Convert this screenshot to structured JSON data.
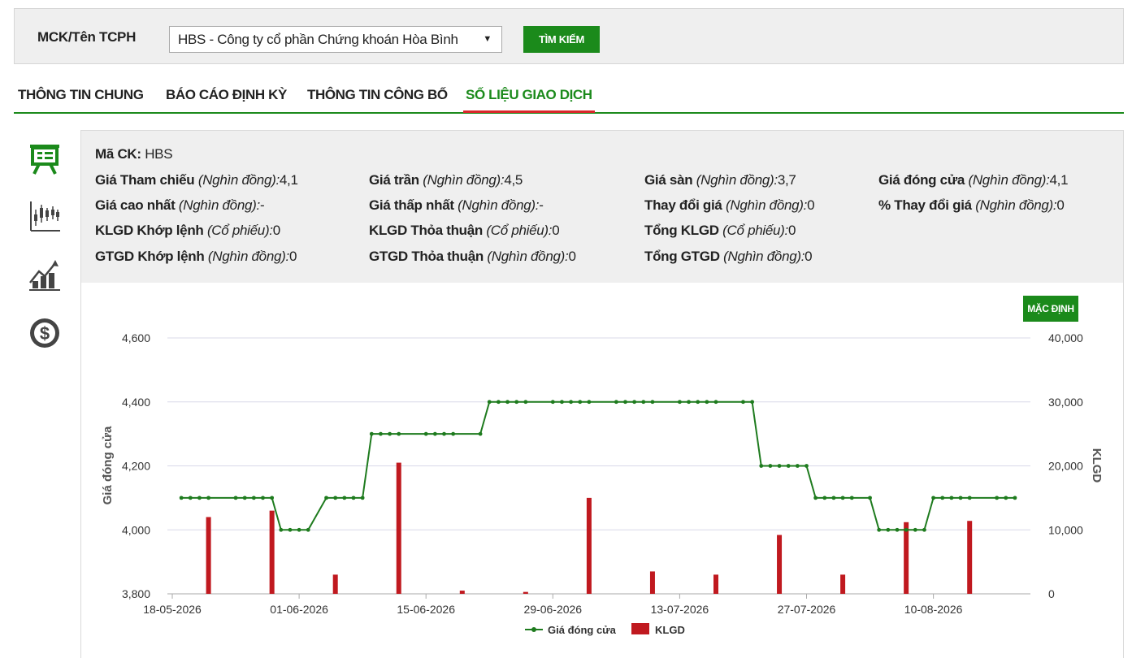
{
  "search": {
    "label": "MCK/Tên TCPH",
    "selected": "HBS - Công ty cổ phần Chứng khoán Hòa Bình",
    "button": "TÌM KIẾM"
  },
  "tabs": [
    {
      "label": "THÔNG TIN CHUNG"
    },
    {
      "label": "BÁO CÁO ĐỊNH KỲ"
    },
    {
      "label": "THÔNG TIN CÔNG BỐ"
    },
    {
      "label": "SỐ LIỆU GIAO DỊCH",
      "active": true
    }
  ],
  "sidebar_icons": [
    "presentation-icon",
    "candlestick-icon",
    "bar-growth-icon",
    "dollar-icon"
  ],
  "info": {
    "code_label": "Mã CK:",
    "code_value": "HBS",
    "fields": [
      {
        "label": "Giá Tham chiếu",
        "unit": "(Nghìn đồng):",
        "value": "4,1"
      },
      {
        "label": "Giá trần",
        "unit": "(Nghìn đồng):",
        "value": "4,5"
      },
      {
        "label": "Giá sàn",
        "unit": "(Nghìn đồng):",
        "value": "3,7"
      },
      {
        "label": "Giá đóng cửa",
        "unit": "(Nghìn đồng):",
        "value": "4,1"
      },
      {
        "label": "Giá cao nhất",
        "unit": "(Nghìn đồng):",
        "value": "-"
      },
      {
        "label": "Giá thấp nhất",
        "unit": "(Nghìn đồng):",
        "value": "-"
      },
      {
        "label": "Thay đổi giá",
        "unit": "(Nghìn đồng):",
        "value": "0"
      },
      {
        "label": "% Thay đổi giá",
        "unit": "(Nghìn đồng):",
        "value": "0"
      },
      {
        "label": "KLGD Khớp lệnh",
        "unit": "(Cổ phiếu):",
        "value": "0"
      },
      {
        "label": "KLGD Thỏa thuận",
        "unit": "(Cổ phiếu):",
        "value": "0"
      },
      {
        "label": "Tổng KLGD",
        "unit": "(Cổ phiếu):",
        "value": "0"
      },
      {
        "label": "GTGD Khớp lệnh",
        "unit": "(Nghìn đồng):",
        "value": "0"
      },
      {
        "label": "GTGD Thỏa thuận",
        "unit": "(Nghìn đồng):",
        "value": "0"
      },
      {
        "label": "Tổng GTGD",
        "unit": "(Nghìn đồng):",
        "value": "0"
      }
    ]
  },
  "chart_button": "MẶC ĐỊNH",
  "colors": {
    "accent": "#1b8a1b",
    "bar": "#c0191f",
    "line": "#1e7b1e",
    "tab_underline": "#d9262a"
  },
  "chart_data": {
    "type": "line",
    "x_tick_labels": [
      "18-05-2026",
      "01-06-2026",
      "15-06-2026",
      "29-06-2026",
      "13-07-2026",
      "27-07-2026",
      "10-08-2026"
    ],
    "x_tick_days": [
      0,
      14,
      28,
      42,
      56,
      70,
      84
    ],
    "ylabel": "Giá đóng cửa",
    "y2label": "KLGD",
    "ylim": [
      3800,
      4600
    ],
    "yticks": [
      3800,
      4000,
      4200,
      4400,
      4600
    ],
    "y2lim": [
      0,
      40000
    ],
    "y2ticks": [
      0,
      10000,
      20000,
      30000,
      40000
    ],
    "legend": [
      "Giá đóng cửa",
      "KLGD"
    ],
    "legend_position": "bottom-center",
    "grid": true,
    "series": [
      {
        "name": "Giá đóng cửa",
        "type": "line",
        "x": [
          1,
          2,
          3,
          4,
          7,
          8,
          9,
          10,
          11,
          12,
          13,
          14,
          15,
          17,
          18,
          19,
          20,
          21,
          22,
          23,
          24,
          25,
          28,
          29,
          30,
          31,
          34,
          35,
          36,
          37,
          38,
          39,
          42,
          43,
          44,
          45,
          46,
          49,
          50,
          51,
          52,
          53,
          56,
          57,
          58,
          59,
          60,
          63,
          64,
          65,
          66,
          67,
          68,
          69,
          70,
          71,
          72,
          73,
          74,
          75,
          77,
          78,
          79,
          80,
          81,
          82,
          83,
          84,
          85,
          86,
          87,
          88,
          91,
          92,
          93
        ],
        "values": [
          4100,
          4100,
          4100,
          4100,
          4100,
          4100,
          4100,
          4100,
          4100,
          4000,
          4000,
          4000,
          4000,
          4100,
          4100,
          4100,
          4100,
          4100,
          4300,
          4300,
          4300,
          4300,
          4300,
          4300,
          4300,
          4300,
          4300,
          4400,
          4400,
          4400,
          4400,
          4400,
          4400,
          4400,
          4400,
          4400,
          4400,
          4400,
          4400,
          4400,
          4400,
          4400,
          4400,
          4400,
          4400,
          4400,
          4400,
          4400,
          4400,
          4200,
          4200,
          4200,
          4200,
          4200,
          4200,
          4100,
          4100,
          4100,
          4100,
          4100,
          4100,
          4000,
          4000,
          4000,
          4000,
          4000,
          4000,
          4100,
          4100,
          4100,
          4100,
          4100,
          4100,
          4100,
          4100
        ]
      },
      {
        "name": "KLGD",
        "type": "bar",
        "x": [
          4,
          11,
          18,
          25,
          32,
          39,
          46,
          53,
          60,
          67,
          74,
          81,
          88
        ],
        "values": [
          12000,
          13000,
          3000,
          20500,
          500,
          300,
          15000,
          3500,
          3000,
          9200,
          3000,
          11200,
          11400
        ]
      }
    ]
  }
}
